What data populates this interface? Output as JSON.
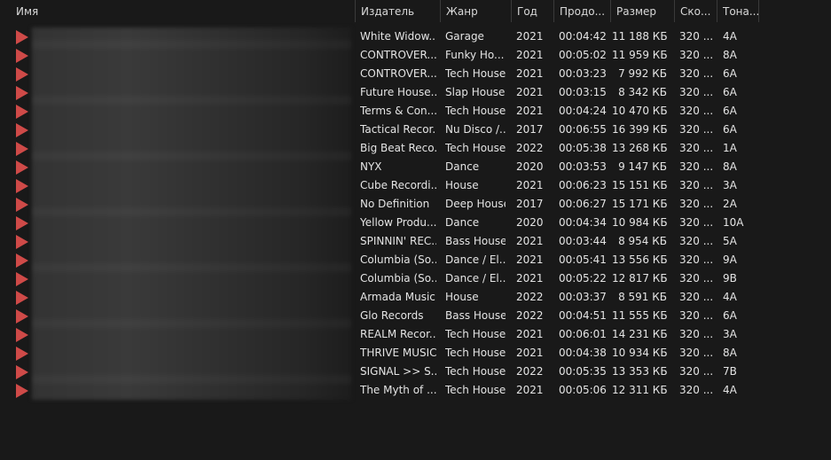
{
  "columns": {
    "name": "Имя",
    "publisher": "Издатель",
    "genre": "Жанр",
    "year": "Год",
    "duration": "Продо...",
    "size": "Размер",
    "bitrate": "Ско...",
    "key": "Тона..."
  },
  "sort_indicator": "^",
  "rows": [
    {
      "publisher": "White Widow...",
      "genre": "Garage",
      "year": "2021",
      "duration": "00:04:42",
      "size": "11 188 КБ",
      "bitrate": "320 ...",
      "key": "4A"
    },
    {
      "publisher": "CONTROVER...",
      "genre": "Funky Ho...",
      "year": "2021",
      "duration": "00:05:02",
      "size": "11 959 КБ",
      "bitrate": "320 ...",
      "key": "8A"
    },
    {
      "publisher": "CONTROVER...",
      "genre": "Tech House",
      "year": "2021",
      "duration": "00:03:23",
      "size": "7 992 КБ",
      "bitrate": "320 ...",
      "key": "6A"
    },
    {
      "publisher": "Future House...",
      "genre": "Slap House",
      "year": "2021",
      "duration": "00:03:15",
      "size": "8 342 КБ",
      "bitrate": "320 ...",
      "key": "6A"
    },
    {
      "publisher": "Terms & Con...",
      "genre": "Tech House",
      "year": "2021",
      "duration": "00:04:24",
      "size": "10 470 КБ",
      "bitrate": "320 ...",
      "key": "6A"
    },
    {
      "publisher": "Tactical Recor...",
      "genre": "Nu Disco /...",
      "year": "2017",
      "duration": "00:06:55",
      "size": "16 399 КБ",
      "bitrate": "320 ...",
      "key": "6A"
    },
    {
      "publisher": "Big Beat Reco...",
      "genre": "Tech House",
      "year": "2022",
      "duration": "00:05:38",
      "size": "13 268 КБ",
      "bitrate": "320 ...",
      "key": "1A"
    },
    {
      "publisher": "NYX",
      "genre": "Dance",
      "year": "2020",
      "duration": "00:03:53",
      "size": "9 147 КБ",
      "bitrate": "320 ...",
      "key": "8A"
    },
    {
      "publisher": "Cube Recordi...",
      "genre": "House",
      "year": "2021",
      "duration": "00:06:23",
      "size": "15 151 КБ",
      "bitrate": "320 ...",
      "key": "3A"
    },
    {
      "publisher": "No Definition",
      "genre": "Deep House",
      "year": "2017",
      "duration": "00:06:27",
      "size": "15 171 КБ",
      "bitrate": "320 ...",
      "key": "2A"
    },
    {
      "publisher": "Yellow Produ...",
      "genre": "Dance",
      "year": "2020",
      "duration": "00:04:34",
      "size": "10 984 КБ",
      "bitrate": "320 ...",
      "key": "10A"
    },
    {
      "publisher": "SPINNIN' REC...",
      "genre": "Bass House",
      "year": "2021",
      "duration": "00:03:44",
      "size": "8 954 КБ",
      "bitrate": "320 ...",
      "key": "5A"
    },
    {
      "publisher": "Columbia (So...",
      "genre": "Dance / El...",
      "year": "2021",
      "duration": "00:05:41",
      "size": "13 556 КБ",
      "bitrate": "320 ...",
      "key": "9A"
    },
    {
      "publisher": "Columbia (So...",
      "genre": "Dance / El...",
      "year": "2021",
      "duration": "00:05:22",
      "size": "12 817 КБ",
      "bitrate": "320 ...",
      "key": "9B"
    },
    {
      "publisher": "Armada Music",
      "genre": "House",
      "year": "2022",
      "duration": "00:03:37",
      "size": "8 591 КБ",
      "bitrate": "320 ...",
      "key": "4A"
    },
    {
      "publisher": "Glo Records",
      "genre": "Bass House",
      "year": "2022",
      "duration": "00:04:51",
      "size": "11 555 КБ",
      "bitrate": "320 ...",
      "key": "6A"
    },
    {
      "publisher": "REALM Recor...",
      "genre": "Tech House",
      "year": "2021",
      "duration": "00:06:01",
      "size": "14 231 КБ",
      "bitrate": "320 ...",
      "key": "3A"
    },
    {
      "publisher": "THRIVE MUSIC",
      "genre": "Tech House",
      "year": "2021",
      "duration": "00:04:38",
      "size": "10 934 КБ",
      "bitrate": "320 ...",
      "key": "8A"
    },
    {
      "publisher": "SIGNAL >> S...",
      "genre": "Tech House",
      "year": "2022",
      "duration": "00:05:35",
      "size": "13 353 КБ",
      "bitrate": "320 ...",
      "key": "7B"
    },
    {
      "publisher": "The Myth of ...",
      "genre": "Tech House",
      "year": "2021",
      "duration": "00:05:06",
      "size": "12 311 КБ",
      "bitrate": "320 ...",
      "key": "4A"
    }
  ],
  "icons": {
    "file": "audio-file-play-icon"
  },
  "colors": {
    "background": "#191919",
    "icon": "#cf4a48",
    "text": "#e4e4e4"
  }
}
